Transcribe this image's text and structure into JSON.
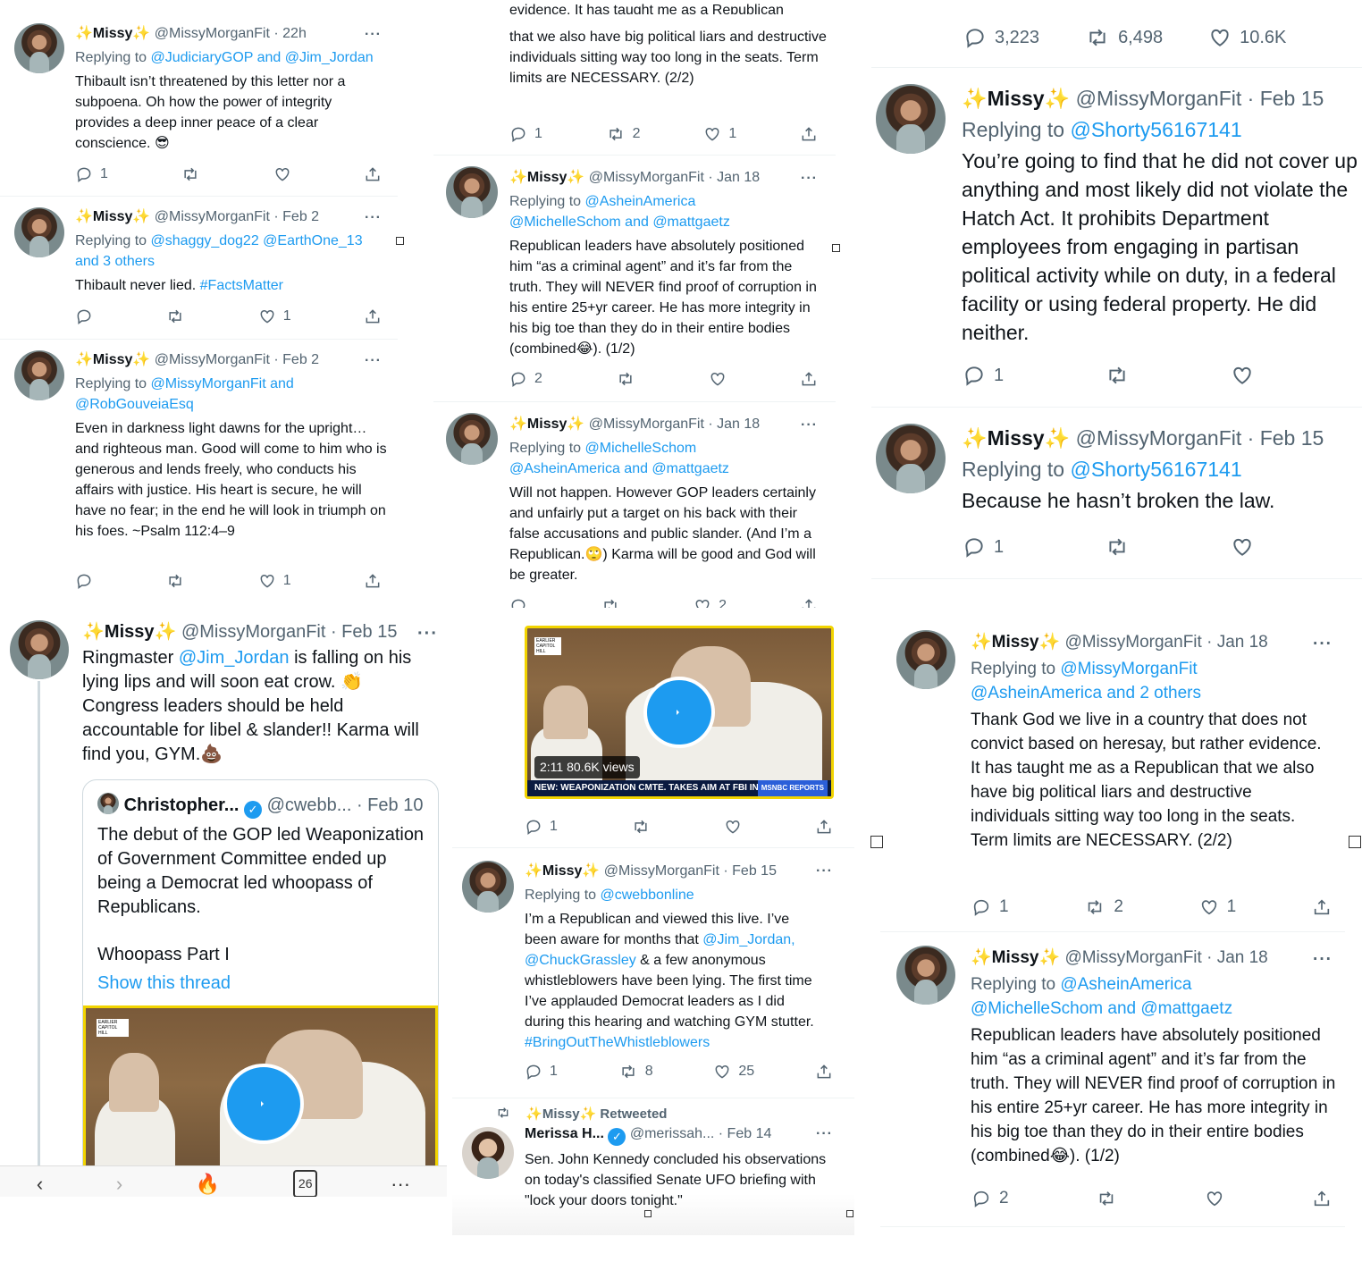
{
  "user": {
    "name": "Missy",
    "handle": "@MissyMorganFit",
    "star": "✨"
  },
  "dots": "···",
  "p1": {
    "t1": {
      "time": "· 22h",
      "reply_prefix": "Replying to",
      "reply_to": "@JudiciaryGOP and @Jim_Jordan",
      "body": "Thibault isn’t threatened by this letter nor a subpoena. Oh how the power of integrity provides a deep inner peace of a clear conscience. 😎",
      "replies": "1",
      "retweets": "",
      "likes": ""
    },
    "t2": {
      "time": "· Feb 2",
      "reply_prefix": "Replying to",
      "reply_to": "@shaggy_dog22 @EarthOne_13 and 3 others",
      "body_text": "Thibault never lied.",
      "body_tag": "#FactsMatter",
      "replies": "",
      "retweets": "",
      "likes": "1"
    },
    "t3": {
      "time": "· Feb 2",
      "reply_prefix": "Replying to",
      "reply_to": "@MissyMorganFit and @RobGouveiaEsq",
      "body": "Even in darkness light dawns for the upright…and righteous man. Good will come to him who is generous and lends freely, who conducts his affairs with justice. His heart is secure, he will have no fear; in the end he will look in triumph on his foes. ~Psalm 112:4–9",
      "replies": "",
      "retweets": "",
      "likes": "1"
    }
  },
  "p2": {
    "cut_top": "evidence. It has taught me as a Republican",
    "t0": {
      "body": "that we also have big political liars and destructive individuals sitting way too long in the seats. Term limits are NECESSARY. (2/2)",
      "replies": "1",
      "retweets": "2",
      "likes": "1"
    },
    "t1": {
      "time": "· Jan 18",
      "reply_prefix": "Replying to",
      "reply_to": "@AsheinAmerica @MichelleSchom and @mattgaetz",
      "body": "Republican leaders have absolutely positioned him “as a criminal agent” and it’s far from the truth. They will NEVER find proof of corruption in his entire 25+yr career. He has more integrity in his big toe than they do in their entire bodies (combined😂). (1/2)",
      "replies": "2",
      "retweets": "",
      "likes": ""
    },
    "t2": {
      "time": "· Jan 18",
      "reply_prefix": "Replying to",
      "reply_to": "@MichelleSchom @AsheinAmerica and @mattgaetz",
      "body": "Will not happen. However GOP leaders certainly and unfairly put a target on his back with their false accusations and public slander. (And I’m a Republican.🙄) Karma will be good and God will be greater.",
      "replies": "",
      "retweets": "",
      "likes": "2"
    }
  },
  "p3": {
    "stats": {
      "replies": "3,223",
      "retweets": "6,498",
      "likes": "10.6K"
    },
    "t1": {
      "time": "· Feb 15",
      "reply_prefix": "Replying to",
      "reply_to": "@Shorty56167141",
      "body": "You’re going to find that he did not cover up anything and most likely did not violate the Hatch Act. It prohibits Department employees from engaging in partisan political activity while on duty, in a federal facility or using federal property. He did neither.",
      "replies": "1",
      "retweets": "",
      "likes": ""
    },
    "t2": {
      "time": "· Feb 15",
      "reply_prefix": "Replying to",
      "reply_to": "@Shorty56167141",
      "body": "Because he hasn’t broken the law.",
      "replies": "1",
      "retweets": "",
      "likes": ""
    }
  },
  "p4": {
    "t1": {
      "time": "· Feb 15",
      "body_a": "Ringmaster",
      "body_link": "@Jim_Jordan",
      "body_b": "is falling on his lying lips and will soon eat crow. 👏 Congress leaders should be held accountable for libel & slander!! Karma will find you, GYM.💩"
    },
    "quote": {
      "name": "Christopher...",
      "handle": "@cwebb...",
      "time": "· Feb 10",
      "body": "The debut of the GOP led Weaponization of Government Committee ended up being a Democrat led whoopass of Republicans.",
      "part": "Whoopass Part I",
      "show": "Show this thread",
      "tag": "EARLIER CAPITOL HILL"
    },
    "tabbar": {
      "back": "‹",
      "forward": "›",
      "fire": "🔥",
      "tabs": "26",
      "menu": "···"
    }
  },
  "p5": {
    "video": {
      "duration": "2:11",
      "views": "80.6K views",
      "chyron": "NEW: WEAPONIZATION CMTE. TAKES AIM AT FBI IN HEARING",
      "network": "MSNBC REPORTS",
      "tag": "EARLIER CAPITOL HILL"
    },
    "t0": {
      "replies": "1",
      "retweets": "",
      "likes": ""
    },
    "t1": {
      "time": "· Feb 15",
      "reply_prefix": "Replying to",
      "reply_to": "@cwebbonline",
      "body_a": "I’m a Republican and viewed this live. I’ve been aware for months that",
      "link1": "@Jim_Jordan,",
      "link2": "@ChuckGrassley",
      "body_b": "& a few anonymous whistleblowers have been lying. The first time I’ve applauded Democrat leaders as I did during this hearing and watching GYM stutter.",
      "tag": "#BringOutTheWhistleblowers",
      "replies": "1",
      "retweets": "8",
      "likes": "25"
    },
    "rt": {
      "label": "Retweeted",
      "name": "Merissa H...",
      "handle": "@merissah...",
      "time": "· Feb 14",
      "body": "Sen. John Kennedy concluded his observations on today's classified Senate UFO briefing with \"lock your doors tonight.\""
    }
  },
  "p6": {
    "t1": {
      "time": "· Jan 18",
      "reply_prefix": "Replying to",
      "reply_to": "@MissyMorganFit @AsheinAmerica and 2 others",
      "body": "Thank God we live in a country that does not convict based on heresay, but rather evidence. It has taught me as a Republican that we also have big political liars and destructive individuals sitting way too long in the seats. Term limits are NECESSARY. (2/2)",
      "replies": "1",
      "retweets": "2",
      "likes": "1"
    },
    "t2": {
      "time": "· Jan 18",
      "reply_prefix": "Replying to",
      "reply_to": "@AsheinAmerica @MichelleSchom and @mattgaetz",
      "body": "Republican leaders have absolutely positioned him “as a criminal agent” and it’s far from the truth. They will NEVER find proof of corruption in his entire 25+yr career. He has more integrity in his big toe than they do in their entire bodies (combined😂). (1/2)",
      "replies": "2",
      "retweets": "",
      "likes": ""
    }
  }
}
